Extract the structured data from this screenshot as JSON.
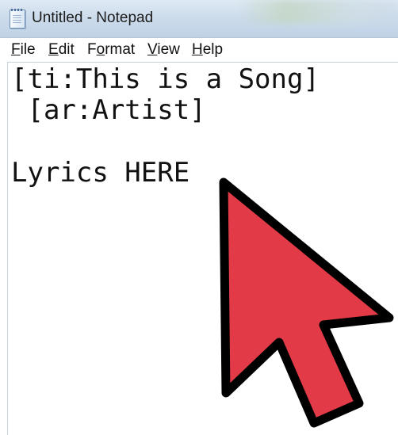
{
  "window": {
    "title": "Untitled - Notepad",
    "icon": "notepad-icon"
  },
  "menu": {
    "items": [
      {
        "label": "File",
        "underline": "F",
        "rest": "ile"
      },
      {
        "label": "Edit",
        "underline": "E",
        "rest": "dit"
      },
      {
        "label": "Format",
        "pre": "F",
        "underline": "o",
        "rest": "rmat"
      },
      {
        "label": "View",
        "underline": "V",
        "rest": "iew"
      },
      {
        "label": "Help",
        "underline": "H",
        "rest": "elp"
      }
    ]
  },
  "document": {
    "lines": [
      "[ti:This is a Song]",
      " [ar:Artist]",
      "",
      "Lyrics HERE"
    ]
  },
  "overlay": {
    "icon": "mouse-pointer-icon",
    "fill_color": "#e23b47",
    "outline_color": "#000000"
  }
}
